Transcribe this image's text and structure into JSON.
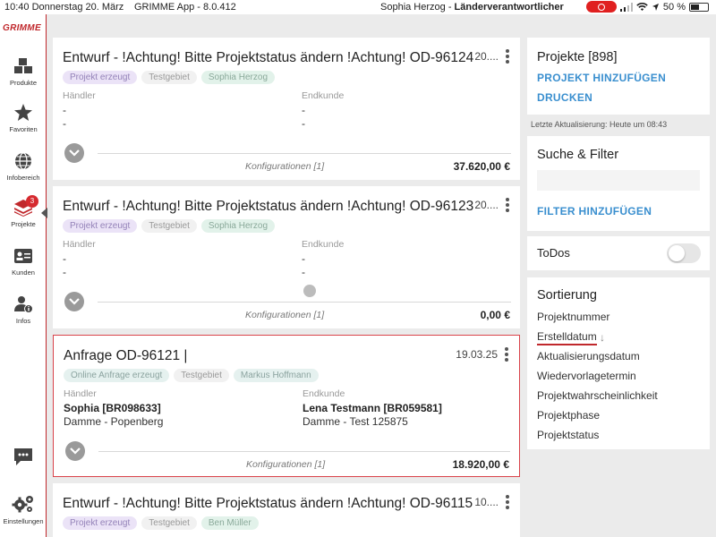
{
  "statusbar": {
    "time_date": "10:40  Donnerstag 20. März",
    "app": "GRIMME App - 8.0.412",
    "user_prefix": "Sophia Herzog - ",
    "user_role": "Länderverantwortlicher",
    "battery": "50 %",
    "colors": {
      "record": "#e02020"
    }
  },
  "sidebar": {
    "logo": "GRIMME",
    "items": [
      {
        "label": "Produkte",
        "icon": "cubes-icon"
      },
      {
        "label": "Favoriten",
        "icon": "star-icon"
      },
      {
        "label": "Infobereich",
        "icon": "globe-icon"
      },
      {
        "label": "Projekte",
        "icon": "layers-icon",
        "badge": "3",
        "active": true
      },
      {
        "label": "Kunden",
        "icon": "contact-card-icon"
      },
      {
        "label": "Infos",
        "icon": "user-info-icon"
      }
    ],
    "chat_icon": "chat-icon",
    "settings_label": "Einstellungen",
    "accent": "#c0282c"
  },
  "projects": [
    {
      "title": "Entwurf - !Achtung! Bitte Projektstatus ändern !Achtung! OD-96124",
      "date": "20....",
      "tags": [
        "Projekt erzeugt",
        "Testgebiet",
        "Sophia Herzog"
      ],
      "haendler_label": "Händler",
      "haendler_lines": [
        "-",
        "-"
      ],
      "endkunde_label": "Endkunde",
      "endkunde_lines": [
        "-",
        "-"
      ],
      "konfigurationen": "Konfigurationen [1]",
      "price": "37.620,00 €"
    },
    {
      "title": "Entwurf - !Achtung! Bitte Projektstatus ändern !Achtung! OD-96123",
      "date": "20....",
      "tags": [
        "Projekt erzeugt",
        "Testgebiet",
        "Sophia Herzog"
      ],
      "haendler_label": "Händler",
      "haendler_lines": [
        "-",
        "-"
      ],
      "endkunde_label": "Endkunde",
      "endkunde_lines": [
        "-",
        "-"
      ],
      "konfigurationen": "Konfigurationen [1]",
      "price": "0,00 €"
    },
    {
      "title": "Anfrage OD-96121 |",
      "date": "19.03.25",
      "tags": [
        "Online Anfrage erzeugt",
        "Testgebiet",
        "Markus Hoffmann"
      ],
      "haendler_label": "Händler",
      "haendler_lines": [
        "Sophia [BR098633]",
        "Damme - Popenberg"
      ],
      "endkunde_label": "Endkunde",
      "endkunde_lines": [
        "Lena Testmann [BR059581]",
        "Damme - Test 125875"
      ],
      "konfigurationen": "Konfigurationen [1]",
      "price": "18.920,00 €",
      "selected": true
    },
    {
      "title": "Entwurf - !Achtung! Bitte Projektstatus ändern !Achtung! OD-96115",
      "date": "10....",
      "tags": [
        "Projekt erzeugt",
        "Testgebiet",
        "Ben Müller"
      ]
    }
  ],
  "right": {
    "projects_title": "Projekte [898]",
    "add_project": "PROJEKT HINZUFÜGEN",
    "print": "DRUCKEN",
    "last_update": "Letzte Aktualisierung: Heute um 08:43",
    "search_title": "Suche & Filter",
    "add_filter": "FILTER HINZUFÜGEN",
    "todos_label": "ToDos",
    "todos_on": false,
    "sort_title": "Sortierung",
    "sort_options": [
      "Projektnummer",
      "Erstelldatum",
      "Aktualisierungsdatum",
      "Wiedervorlagetermin",
      "Projektwahrscheinlichkeit",
      "Projektphase",
      "Projektstatus"
    ],
    "sort_active": "Erstelldatum",
    "link_color": "#3a8fcf"
  }
}
